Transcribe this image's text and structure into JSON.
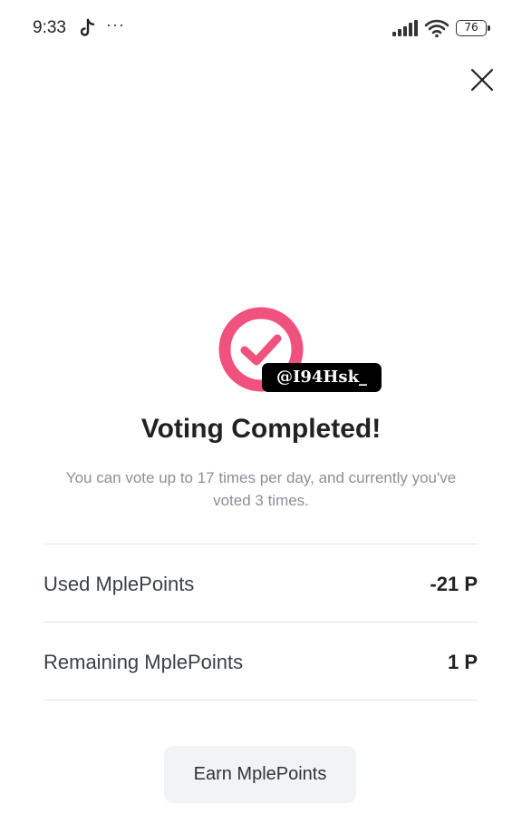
{
  "status_bar": {
    "time": "9:33",
    "dots": "···",
    "battery": "76"
  },
  "dialog": {
    "title": "Voting Completed!",
    "subtitle": "You can vote up to 17 times per day, and currently you've voted 3 times.",
    "watermark": "@I94Hsk_",
    "rows": [
      {
        "label": "Used MplePoints",
        "value": "-21 P"
      },
      {
        "label": "Remaining MplePoints",
        "value": "1 P"
      }
    ],
    "earn_button_label": "Earn MplePoints"
  },
  "colors": {
    "accent": "#f0527e",
    "text": "#222222",
    "muted": "#8a8f98",
    "button_bg": "#f2f3f5"
  }
}
